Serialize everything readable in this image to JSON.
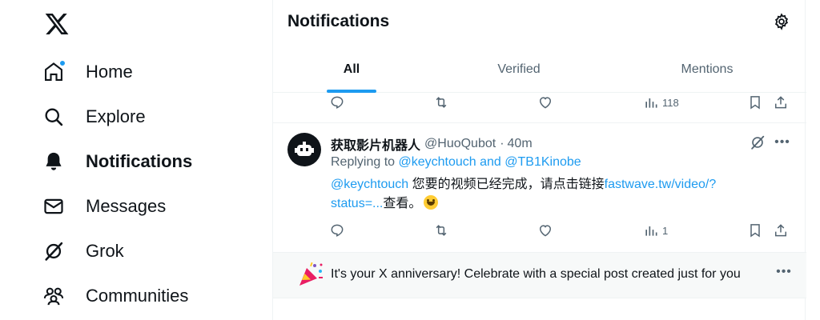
{
  "sidebar": {
    "logo": "x-logo-icon",
    "items": [
      {
        "label": "Home",
        "icon": "home-icon"
      },
      {
        "label": "Explore",
        "icon": "search-icon"
      },
      {
        "label": "Notifications",
        "icon": "bell-icon"
      },
      {
        "label": "Messages",
        "icon": "envelope-icon"
      },
      {
        "label": "Grok",
        "icon": "grok-icon"
      },
      {
        "label": "Communities",
        "icon": "communities-icon"
      }
    ],
    "accent_color": "#1d9bf0"
  },
  "header": {
    "title": "Notifications",
    "settings_icon": "gear-icon"
  },
  "tabs": [
    {
      "label": "All",
      "active": true
    },
    {
      "label": "Verified",
      "active": false
    },
    {
      "label": "Mentions",
      "active": false
    }
  ],
  "prev_post_actions": {
    "views": "118"
  },
  "post": {
    "author": "获取影片机器人",
    "handle": "@HuoQubot",
    "separator": "·",
    "time": "40m",
    "replying_prefix": "Replying to ",
    "replying_users": "@keychtouch and @TB1Kinobe",
    "mention": "@keychtouch",
    "text": " 您要的视频已经完成，请点击链接",
    "link": "fastwave.tw/video/?status=...",
    "text_after": "查看。",
    "emoji": "grinning-face-emoji",
    "actions": {
      "views": "1"
    }
  },
  "anniversary": {
    "text": "It's your X anniversary! Celebrate with a special post created just for you",
    "icon": "party-popper-icon"
  }
}
